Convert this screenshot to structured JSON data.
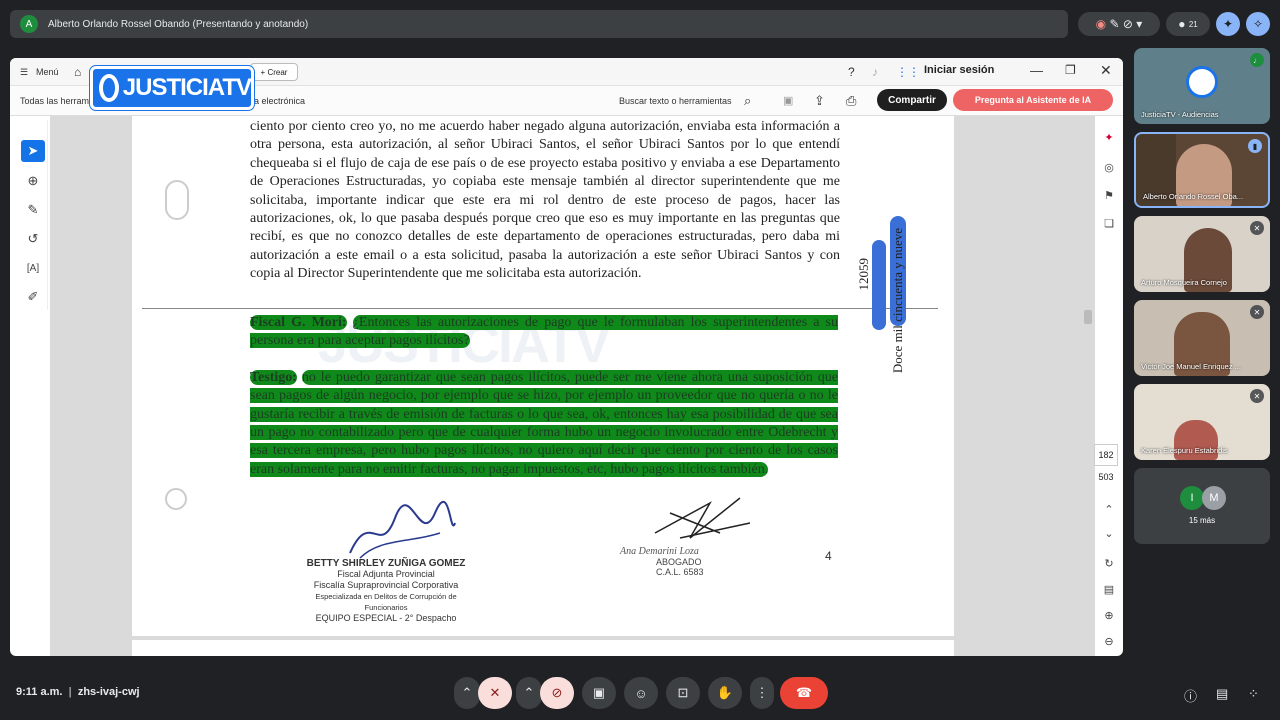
{
  "meet": {
    "presenter_initial": "A",
    "presenter_label": "Alberto Orlando Rossel Obando (Presentando y anotando)",
    "participant_count": "21",
    "meeting_time": "9:11 a.m.",
    "meeting_code": "zhs-ivaj-cwj"
  },
  "acrobat": {
    "menu_label": "Menú",
    "crear_label": "+ Crear",
    "signin_label": "Iniciar sesión",
    "tools_label": "Todas las herram",
    "firma_label": "a electrónica",
    "search_placeholder": "Buscar texto o herramientas",
    "share_label": "Compartir",
    "ai_label": "Pregunta al Asistente de IA",
    "page_current": "182",
    "page_total": "503"
  },
  "logo": {
    "text": "JUSTICIATV"
  },
  "watermark": "JUSTICIATV",
  "document": {
    "paragraph": "ciento por ciento creo yo, no me acuerdo haber negado alguna autorización, enviaba esta información a otra persona, esta autorización, al señor Ubiraci Santos, el señor Ubiraci Santos por lo que entendí chequeaba si el flujo de caja de ese país o de ese proyecto estaba positivo y enviaba a ese Departamento de Operaciones Estructuradas, yo copiaba este mensaje también al director superintendente que me solicitaba, importante indicar que este era mi rol dentro de este proceso de pagos, hacer las autorizaciones, ok, lo que pasaba después porque creo que eso es muy importante en las preguntas que recibí, es que no conozco detalles de este departamento de operaciones estructuradas, pero daba mi autorización a este email o a esta solicitud, pasaba la autorización a este señor Ubiraci Santos y con copia al Director Superintendente que me solicitaba esta autorización.",
    "fiscal_label": "Fiscal G. Mori:",
    "fiscal_text": "¿Entonces las autorizaciones de pago que le formulaban los superintendentes a su persona era para aceptar pagos ilícitos?",
    "testigo_label": "Testigo:",
    "testigo_text": "no le puedo garantizar que sean pagos ilícitos, puede ser me viene ahora una suposición que sean pagos de algún negocio, por ejemplo que se hizo, por ejemplo un proveedor que no quería o no le gustaría recibir a través de emisión de facturas o lo que sea, ok, entonces hay esa posibilidad de que sea un pago no contabilizado pero que de cualquier forma hubo un negocio involucrado entre Odebrecht y esa tercera empresa, pero hubo pagos ilícitos, no quiero aquí decir que ciento por ciento de los casos eran solamente para no emitir facturas, no pagar impuestos, etc, hubo pagos ilícitos también.",
    "folio_number": "12059",
    "folio_words": "Doce mil cincuenta y nueve",
    "page_number": "4",
    "signature1": {
      "name": "BETTY SHIRLEY ZUÑIGA GOMEZ",
      "line1": "Fiscal Adjunta Provincial",
      "line2": "Fiscalía Supraprovincial Corporativa",
      "line3": "Especializada en Delitos de Corrupción de Funcionarios",
      "line4": "EQUIPO ESPECIAL - 2° Despacho"
    },
    "signature2": {
      "name": "Ana Demarini Loza",
      "title": "ABOGADO",
      "reg": "C.A.L. 6583"
    }
  },
  "participants": [
    {
      "name": "JusticiaTV - Audiencias"
    },
    {
      "name": "Alberto Orlando Rossel Oba..."
    },
    {
      "name": "Arturo Mosqueira Cornejo"
    },
    {
      "name": "Victor Joe Manuel Enriquez ..."
    },
    {
      "name": "Karen Elespuru Estabridis"
    }
  ],
  "more": {
    "initial1": "I",
    "initial2": "M",
    "label": "15 más"
  },
  "colors": {
    "highlight": "#0f8a1a",
    "blue_mark": "#3a6fd8",
    "end_call": "#ea4335",
    "logo": "#1a73e8"
  }
}
